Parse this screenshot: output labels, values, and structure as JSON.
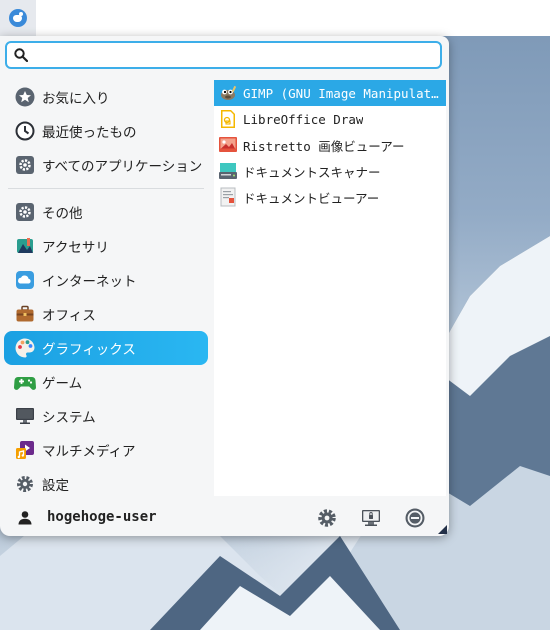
{
  "panel": {
    "launcher_icon": "kde-launcher-icon"
  },
  "search": {
    "value": "",
    "placeholder": ""
  },
  "categories": [
    {
      "label": "お気に入り",
      "icon": "star-icon"
    },
    {
      "label": "最近使ったもの",
      "icon": "clock-icon"
    },
    {
      "label": "すべてのアプリケーション",
      "icon": "apps-gear-icon"
    },
    {
      "label": "その他",
      "icon": "other-gear-icon"
    },
    {
      "label": "アクセサリ",
      "icon": "accessories-icon"
    },
    {
      "label": "インターネット",
      "icon": "cloud-icon"
    },
    {
      "label": "オフィス",
      "icon": "briefcase-icon"
    },
    {
      "label": "グラフィックス",
      "icon": "palette-icon",
      "active": true
    },
    {
      "label": "ゲーム",
      "icon": "gamepad-icon"
    },
    {
      "label": "システム",
      "icon": "monitor-icon"
    },
    {
      "label": "マルチメディア",
      "icon": "multimedia-icon"
    },
    {
      "label": "設定",
      "icon": "settings-gear-icon"
    }
  ],
  "apps": [
    {
      "label": "GIMP (GNU Image Manipulati…",
      "icon": "gimp-icon",
      "active": true
    },
    {
      "label": "LibreOffice Draw",
      "icon": "libreoffice-draw-icon"
    },
    {
      "label": "Ristretto 画像ビューアー",
      "icon": "ristretto-icon"
    },
    {
      "label": "ドキュメントスキャナー",
      "icon": "scanner-icon"
    },
    {
      "label": "ドキュメントビューアー",
      "icon": "document-viewer-icon"
    }
  ],
  "footer": {
    "user_name": "hogehoge-user",
    "buttons": [
      "settings-icon",
      "lock-screen-icon",
      "logout-icon"
    ]
  },
  "colors": {
    "accent": "#3daee9",
    "active_category": "#1ba0e2",
    "active_app": "#2ba8e6"
  }
}
